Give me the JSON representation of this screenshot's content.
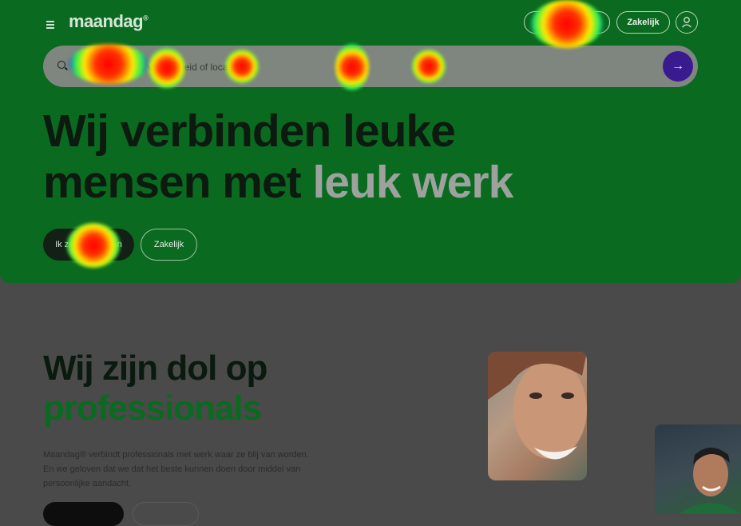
{
  "header": {
    "logo": "maandag",
    "logo_mark": "®",
    "zakelijk_label": "Zakelijk"
  },
  "search": {
    "placeholder": "Zoek op functie, vaardigheid of locatie"
  },
  "hero": {
    "headline_line1": "Wij verbinden leuke",
    "headline_line2_dark": "mensen met ",
    "headline_line2_accent": "leuk werk",
    "cta_primary": "Ik zoek een baan",
    "cta_secondary": "Zakelijk"
  },
  "section": {
    "title_line1": "Wij zijn dol op",
    "title_line2": "professionals",
    "body": "Maandag® verbindt professionals met werk waar ze blij van worden. En we geloven dat we dat het beste kunnen doen door middel van persoonlijke aandacht."
  },
  "colors": {
    "hero_green": "#0a6a1f",
    "brand_purple": "#3a1a8f"
  },
  "icons": [
    "menu-icon",
    "user-icon",
    "search-icon",
    "arrow-right-icon"
  ]
}
